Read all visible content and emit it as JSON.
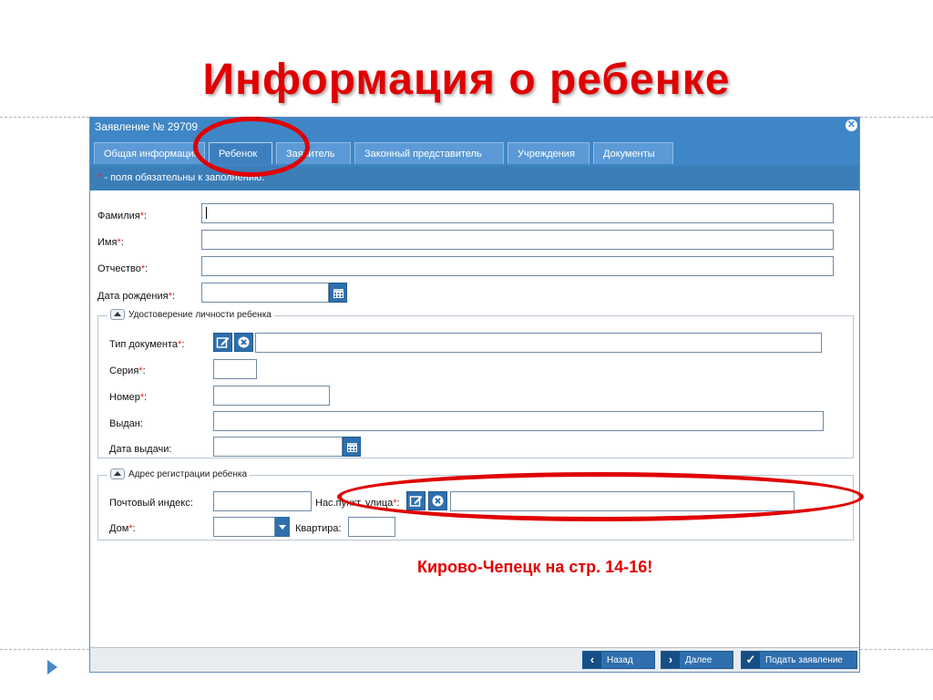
{
  "slide": {
    "title": "Информация о ребенке",
    "note": "Кирово-Чепецк  на стр. 14-16!"
  },
  "dialog": {
    "title": "Заявление № 29709",
    "required_note": "- поля обязательны к заполнению.",
    "required_star": "*"
  },
  "tabs": [
    {
      "label": "Общая информация"
    },
    {
      "label": "Ребенок"
    },
    {
      "label": "Заявитель"
    },
    {
      "label": "Законный представитель"
    },
    {
      "label": "Учреждения"
    },
    {
      "label": "Документы"
    }
  ],
  "child": {
    "surname_label": "Фамилия",
    "name_label": "Имя",
    "patronymic_label": "Отчество",
    "birthdate_label": "Дата рождения"
  },
  "identity": {
    "legend": "Удостоверение личности ребенка",
    "doc_type_label": "Тип документа",
    "series_label": "Серия",
    "number_label": "Номер",
    "issued_by_label": "Выдан:",
    "issue_date_label": "Дата выдачи:"
  },
  "address": {
    "legend": "Адрес регистрации ребенка",
    "postal_label": "Почтовый индекс:",
    "locality_label": "Нас.пункт, улица",
    "house_label": "Дом",
    "apartment_label": "Квартира:"
  },
  "footer": {
    "back_label": "Назад",
    "next_label": "Далее",
    "submit_label": "Подать заявление"
  },
  "colors": {
    "accent": "#3f86c7",
    "highlight": "#e00000"
  }
}
